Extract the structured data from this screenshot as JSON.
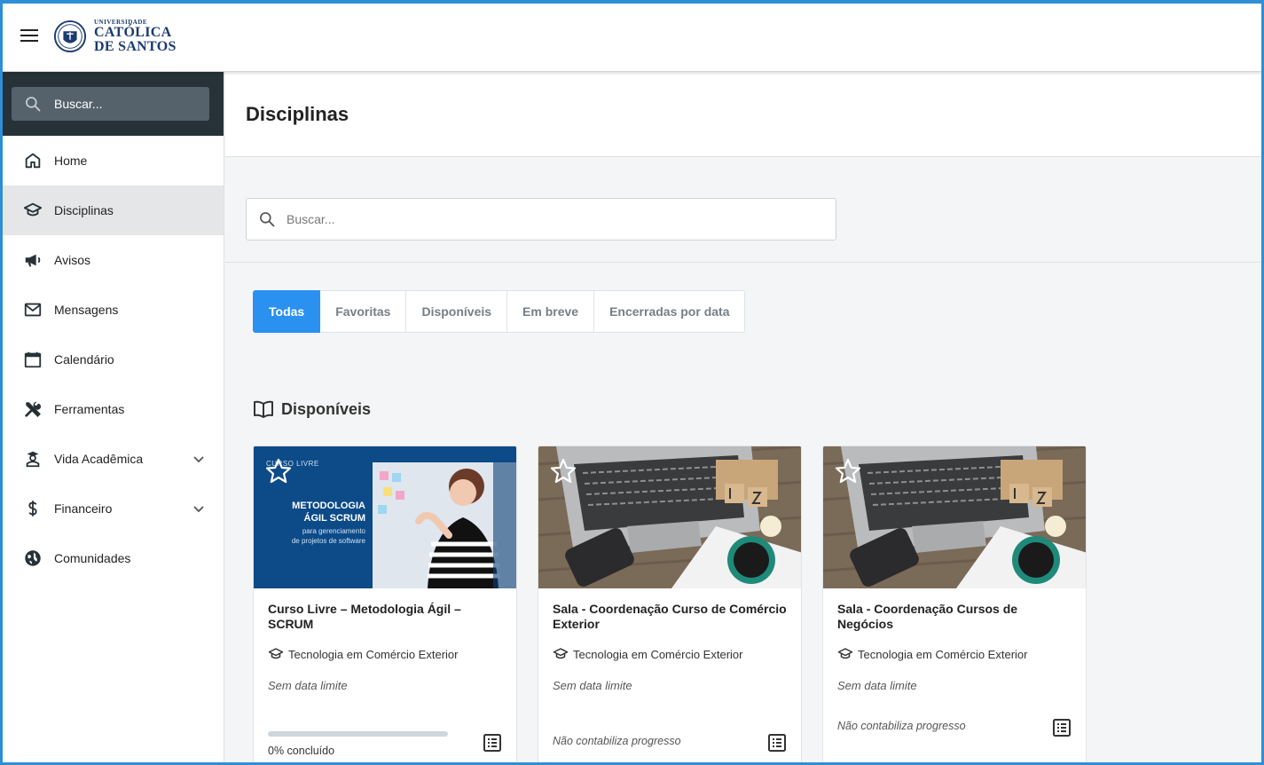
{
  "header": {
    "logo": {
      "line1": "UNIVERSIDADE",
      "line2": "CATÓLICA",
      "line3": "DE SANTOS"
    },
    "menu_icon": "hamburger-icon"
  },
  "sidebar": {
    "search_placeholder": "Buscar...",
    "items": [
      {
        "label": "Home",
        "icon": "home-icon"
      },
      {
        "label": "Disciplinas",
        "icon": "graduation-cap-icon",
        "active": true
      },
      {
        "label": "Avisos",
        "icon": "megaphone-icon"
      },
      {
        "label": "Mensagens",
        "icon": "mail-icon"
      },
      {
        "label": "Calendário",
        "icon": "calendar-icon"
      },
      {
        "label": "Ferramentas",
        "icon": "tools-icon"
      },
      {
        "label": "Vida Acadêmica",
        "icon": "student-icon",
        "expandable": true
      },
      {
        "label": "Financeiro",
        "icon": "dollar-icon",
        "expandable": true
      },
      {
        "label": "Comunidades",
        "icon": "globe-icon"
      }
    ]
  },
  "main": {
    "title": "Disciplinas",
    "search_placeholder": "Buscar...",
    "tabs": [
      {
        "label": "Todas",
        "active": true
      },
      {
        "label": "Favoritas"
      },
      {
        "label": "Disponíveis"
      },
      {
        "label": "Em breve"
      },
      {
        "label": "Encerradas por data"
      }
    ],
    "section_title": "Disponíveis",
    "cards": [
      {
        "title": "Curso Livre – Metodologia Ágil – SCRUM",
        "course": "Tecnologia em Comércio Exterior",
        "deadline": "Sem data limite",
        "progress_percent": 0,
        "progress_label": "0% concluído",
        "banner": {
          "tag": "CURSO LIVRE",
          "headline1": "METODOLOGIA",
          "headline2": "ÁGIL SCRUM",
          "sub1": "para gerenciamento",
          "sub2": "de projetos de software"
        }
      },
      {
        "title": "Sala - Coordenação Curso de Comércio Exterior",
        "course": "Tecnologia em Comércio Exterior",
        "deadline": "Sem data limite",
        "note": "Não contabiliza progresso"
      },
      {
        "title": "Sala - Coordenação Cursos de Negócios",
        "course": "Tecnologia em Comércio Exterior",
        "deadline": "Sem data limite",
        "note": "Não contabiliza progresso"
      }
    ]
  },
  "colors": {
    "accent": "#2b91f0",
    "sidebar_dark": "#263238",
    "frame": "#2e8fd6",
    "logo": "#1b3a70"
  }
}
